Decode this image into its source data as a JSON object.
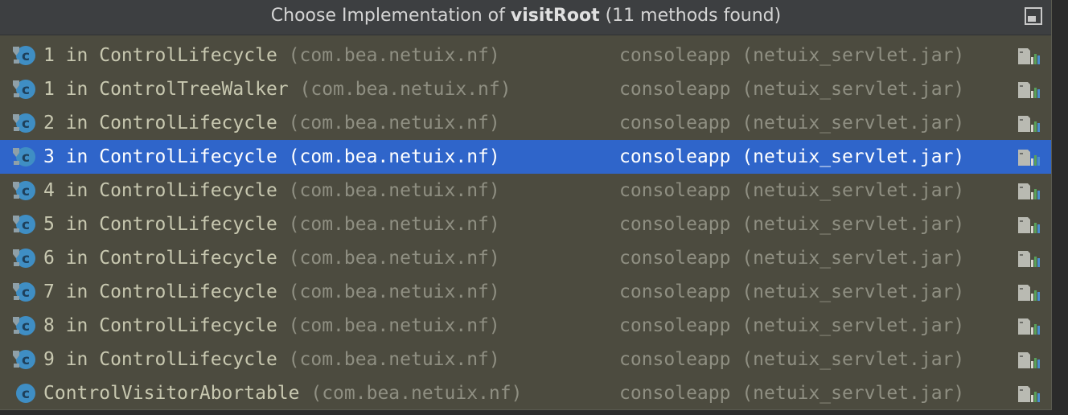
{
  "popup": {
    "title_prefix": "Choose Implementation of ",
    "title_method": "visitRoot",
    "title_suffix": " (11 methods found)"
  },
  "colors": {
    "background": "#4c4b3f",
    "titlebar": "#3d3f41",
    "selection": "#2f65ca",
    "primary_text": "#c8c8b0",
    "secondary_text": "#8f8f82"
  },
  "rows": [
    {
      "label": "1 in ControlLifecycle",
      "package": "(com.bea.netuix.nf)",
      "location": "consoleapp (netuix_servlet.jar)",
      "icon": "class-method-icon",
      "selected": false
    },
    {
      "label": "1 in ControlTreeWalker",
      "package": "(com.bea.netuix.nf)",
      "location": "consoleapp (netuix_servlet.jar)",
      "icon": "class-method-icon",
      "selected": false
    },
    {
      "label": "2 in ControlLifecycle",
      "package": "(com.bea.netuix.nf)",
      "location": "consoleapp (netuix_servlet.jar)",
      "icon": "class-method-icon",
      "selected": false
    },
    {
      "label": "3 in ControlLifecycle",
      "package": "(com.bea.netuix.nf)",
      "location": "consoleapp (netuix_servlet.jar)",
      "icon": "class-method-icon",
      "selected": true
    },
    {
      "label": "4 in ControlLifecycle",
      "package": "(com.bea.netuix.nf)",
      "location": "consoleapp (netuix_servlet.jar)",
      "icon": "class-method-icon",
      "selected": false
    },
    {
      "label": "5 in ControlLifecycle",
      "package": "(com.bea.netuix.nf)",
      "location": "consoleapp (netuix_servlet.jar)",
      "icon": "class-method-icon",
      "selected": false
    },
    {
      "label": "6 in ControlLifecycle",
      "package": "(com.bea.netuix.nf)",
      "location": "consoleapp (netuix_servlet.jar)",
      "icon": "class-method-icon",
      "selected": false
    },
    {
      "label": "7 in ControlLifecycle",
      "package": "(com.bea.netuix.nf)",
      "location": "consoleapp (netuix_servlet.jar)",
      "icon": "class-method-icon",
      "selected": false
    },
    {
      "label": "8 in ControlLifecycle",
      "package": "(com.bea.netuix.nf)",
      "location": "consoleapp (netuix_servlet.jar)",
      "icon": "class-method-icon",
      "selected": false
    },
    {
      "label": "9 in ControlLifecycle",
      "package": "(com.bea.netuix.nf)",
      "location": "consoleapp (netuix_servlet.jar)",
      "icon": "class-method-icon",
      "selected": false
    },
    {
      "label": "ControlVisitorAbortable",
      "package": "(com.bea.netuix.nf)",
      "location": "consoleapp (netuix_servlet.jar)",
      "icon": "class-icon",
      "selected": false
    }
  ]
}
